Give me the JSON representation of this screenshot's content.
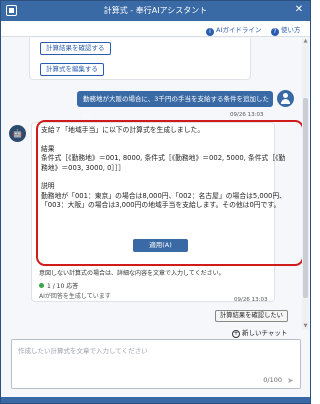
{
  "window": {
    "title": "計算式 - 奉行AIアシスタント"
  },
  "toolbar": {
    "guide_label": "AIガイドライン",
    "help_label": "使い方"
  },
  "previous": {
    "buttons": [
      "計算結果を確認する",
      "計算式を編集する"
    ]
  },
  "user_message": {
    "text": "勤務地が大阪の場合に、3千円の手当を支給する条件を追加したい",
    "time": "09/26 13:03"
  },
  "ai_message": {
    "avatar_glyph": "🤖",
    "intro": "支給７「地域手当」に以下の計算式を生成しました。",
    "result_heading": "結果",
    "result_text": "条件式［《勤務地》＝001, 8000, 条件式［《勤務地》＝002, 5000, 条件式［《勤務地》＝003, 3000, 0］］］",
    "explanation_heading": "説明",
    "explanation_text": "勤務地が「001：東京」の場合は8,000円、「002：名古屋」の場合は5,000円、「003：大阪」の場合は3,000円の地域手当を支給します。その他は0円です。",
    "apply_label": "適用(A)",
    "note": "意図しない計算式の場合は、詳細な内容を文章で入力してください。",
    "count": "1 / 10 応答",
    "time": "09/26 13:03",
    "status": "AIが回答を生成しています"
  },
  "actions": {
    "confirm_label": "計算結果を確認したい",
    "new_chat_label": "新しいチャット"
  },
  "input": {
    "placeholder": "作成したい計算式を文章で入力してください",
    "value": "",
    "counter": "0/100"
  }
}
